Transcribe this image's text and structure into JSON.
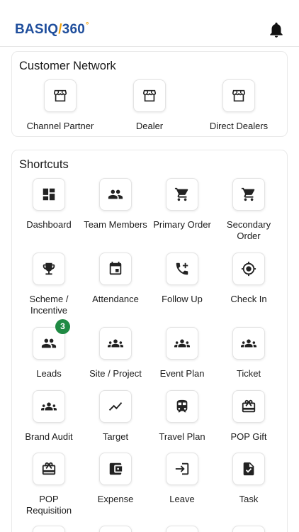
{
  "app": {
    "logo_left": "BASIQ",
    "logo_slash": "/",
    "logo_right": "360",
    "logo_degree": "°",
    "brand_colors": {
      "primary": "#1f4e9c",
      "accent": "#f2a20c"
    },
    "notifications_icon": "bell-icon"
  },
  "customer_network": {
    "title": "Customer Network",
    "items": [
      {
        "label": "Channel Partner",
        "icon": "storefront-icon"
      },
      {
        "label": "Dealer",
        "icon": "storefront-icon"
      },
      {
        "label": "Direct Dealers",
        "icon": "storefront-icon"
      }
    ]
  },
  "shortcuts": {
    "title": "Shortcuts",
    "items": [
      {
        "label": "Dashboard",
        "icon": "dashboard-icon"
      },
      {
        "label": "Team Members",
        "icon": "people-icon"
      },
      {
        "label": "Primary Order",
        "icon": "cart-icon"
      },
      {
        "label": "Secondary Order",
        "icon": "cart-icon"
      },
      {
        "label": "Scheme / Incentive",
        "icon": "trophy-icon"
      },
      {
        "label": "Attendance",
        "icon": "calendar-icon"
      },
      {
        "label": "Follow Up",
        "icon": "phone-add-icon"
      },
      {
        "label": "Check In",
        "icon": "location-target-icon"
      },
      {
        "label": "Leads",
        "icon": "people-icon",
        "badge": "3",
        "badge_color": "#1f8a43"
      },
      {
        "label": "Site / Project",
        "icon": "groups-icon"
      },
      {
        "label": "Event Plan",
        "icon": "groups-icon"
      },
      {
        "label": "Ticket",
        "icon": "groups-icon"
      },
      {
        "label": "Brand Audit",
        "icon": "groups-icon"
      },
      {
        "label": "Target",
        "icon": "trend-icon"
      },
      {
        "label": "Travel Plan",
        "icon": "train-icon"
      },
      {
        "label": "POP Gift",
        "icon": "gift-card-icon"
      },
      {
        "label": "POP Requisition",
        "icon": "gift-card-icon"
      },
      {
        "label": "Expense",
        "icon": "wallet-icon"
      },
      {
        "label": "Leave",
        "icon": "login-icon"
      },
      {
        "label": "Task",
        "icon": "task-icon"
      }
    ]
  }
}
